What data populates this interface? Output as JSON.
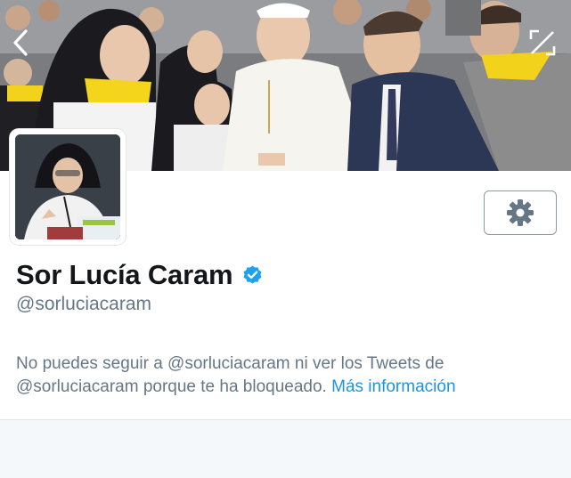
{
  "header": {
    "back_icon": "chevron-left-icon",
    "expand_icon": "fullscreen-expand-icon"
  },
  "profile": {
    "name": "Sor Lucía Caram",
    "verified": true,
    "verified_color": "#1da1f2",
    "handle": "@sorluciacaram",
    "settings_icon": "gear-icon"
  },
  "blocked_notice": {
    "text": "No puedes seguir a @sorluciacaram ni ver los Tweets de @sorluciacaram porque te ha bloqueado.",
    "link_label": "Más información",
    "link_color": "#1b95e0"
  },
  "colors": {
    "page_background": "#f5f8fa",
    "card_background": "#ffffff",
    "text_primary": "#14171a",
    "text_secondary": "#657786"
  }
}
